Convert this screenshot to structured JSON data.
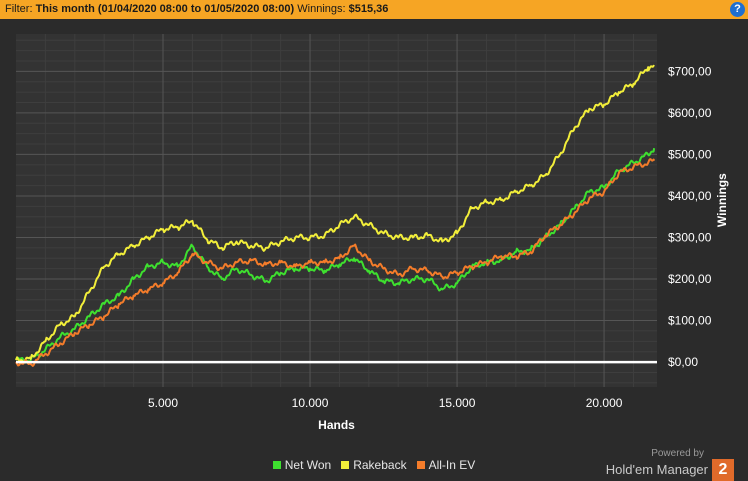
{
  "filter_bar": {
    "label": "Filter:",
    "period": "This month (01/04/2020 08:00 to 01/05/2020 08:00)",
    "winnings_label": "Winnings:",
    "winnings_value": "$515,36",
    "help_glyph": "?"
  },
  "branding": {
    "powered_by": "Powered by",
    "name": "Hold'em Manager",
    "logo_text": "2"
  },
  "chart_data": {
    "type": "line",
    "xlabel": "Hands",
    "ylabel": "Winnings",
    "xlim": [
      0,
      21800
    ],
    "ylim": [
      -60,
      790
    ],
    "x_ticks": [
      5000,
      10000,
      15000,
      20000
    ],
    "x_tick_labels": [
      "5.000",
      "10.000",
      "15.000",
      "20.000"
    ],
    "y_ticks": [
      0,
      100,
      200,
      300,
      400,
      500,
      600,
      700
    ],
    "y_tick_labels": [
      "$0,00",
      "$100,00",
      "$200,00",
      "$300,00",
      "$400,00",
      "$500,00",
      "$600,00",
      "$700,00"
    ],
    "grid": true,
    "legend_position": "bottom",
    "zero_line_color": "#ffffff",
    "series": [
      {
        "name": "Net Won",
        "color": "#3ee02f",
        "x": [
          0,
          500,
          1000,
          1500,
          2000,
          2500,
          3000,
          3500,
          4000,
          4500,
          5000,
          5500,
          6000,
          6500,
          7000,
          7500,
          8000,
          8500,
          9000,
          9500,
          10000,
          10500,
          11000,
          11500,
          12000,
          12500,
          13000,
          13500,
          14000,
          14500,
          15000,
          15500,
          16000,
          16500,
          17000,
          17500,
          18000,
          18500,
          19000,
          19500,
          20000,
          20500,
          21000,
          21500,
          21700
        ],
        "y": [
          5,
          5,
          30,
          60,
          80,
          110,
          140,
          160,
          200,
          230,
          240,
          230,
          280,
          230,
          200,
          225,
          210,
          195,
          215,
          225,
          225,
          220,
          235,
          250,
          220,
          195,
          190,
          200,
          200,
          175,
          190,
          230,
          240,
          245,
          265,
          270,
          300,
          330,
          370,
          410,
          420,
          460,
          480,
          500,
          515
        ]
      },
      {
        "name": "Rakeback",
        "color": "#f2ee3a",
        "x": [
          0,
          500,
          1000,
          1500,
          2000,
          2500,
          3000,
          3500,
          4000,
          4500,
          5000,
          5500,
          6000,
          6500,
          7000,
          7500,
          8000,
          8500,
          9000,
          9500,
          10000,
          10500,
          11000,
          11500,
          12000,
          12500,
          13000,
          13500,
          14000,
          14500,
          15000,
          15500,
          16000,
          16500,
          17000,
          17500,
          18000,
          18500,
          19000,
          19500,
          20000,
          20500,
          21000,
          21500,
          21700
        ],
        "y": [
          5,
          8,
          50,
          90,
          110,
          170,
          230,
          260,
          280,
          300,
          320,
          325,
          340,
          295,
          275,
          290,
          280,
          275,
          290,
          300,
          300,
          305,
          330,
          350,
          330,
          310,
          300,
          300,
          305,
          290,
          310,
          370,
          385,
          390,
          410,
          425,
          450,
          500,
          565,
          610,
          620,
          650,
          670,
          710,
          712
        ]
      },
      {
        "name": "All-In EV",
        "color": "#f47c2a",
        "x": [
          0,
          500,
          1000,
          1500,
          2000,
          2500,
          3000,
          3500,
          4000,
          4500,
          5000,
          5500,
          6000,
          6500,
          7000,
          7500,
          8000,
          8500,
          9000,
          9500,
          10000,
          10500,
          11000,
          11500,
          12000,
          12500,
          13000,
          13500,
          14000,
          14500,
          15000,
          15500,
          16000,
          16500,
          17000,
          17500,
          18000,
          18500,
          19000,
          19500,
          20000,
          20500,
          21000,
          21500,
          21700
        ],
        "y": [
          0,
          -5,
          20,
          45,
          70,
          90,
          110,
          140,
          160,
          175,
          190,
          215,
          260,
          240,
          225,
          240,
          245,
          235,
          240,
          230,
          240,
          240,
          250,
          280,
          245,
          225,
          210,
          225,
          220,
          205,
          215,
          230,
          240,
          255,
          255,
          265,
          305,
          330,
          360,
          395,
          410,
          455,
          470,
          480,
          485
        ]
      }
    ]
  }
}
